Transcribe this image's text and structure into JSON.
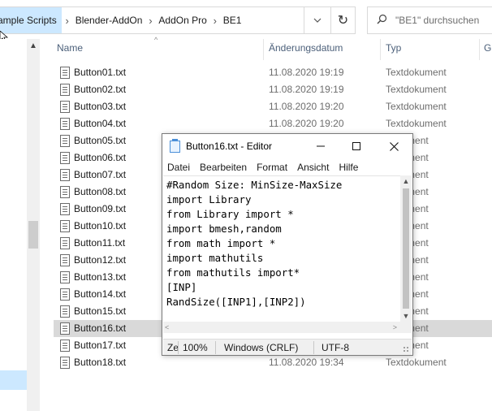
{
  "explorer": {
    "breadcrumbs": [
      "ample Scripts",
      "Blender-AddOn",
      "AddOn Pro",
      "BE1"
    ],
    "search_placeholder": "\"BE1\" durchsuchen",
    "columns": {
      "name": "Name",
      "date": "Änderungsdatum",
      "type": "Typ",
      "size": "Gr"
    },
    "files": [
      {
        "name": "Button01.txt",
        "date": "11.08.2020 19:19",
        "type": "Textdokument"
      },
      {
        "name": "Button02.txt",
        "date": "11.08.2020 19:19",
        "type": "Textdokument"
      },
      {
        "name": "Button03.txt",
        "date": "11.08.2020 19:20",
        "type": "Textdokument"
      },
      {
        "name": "Button04.txt",
        "date": "11.08.2020 19:20",
        "type": "Textdokument"
      },
      {
        "name": "Button05.txt",
        "date": "",
        "type": "dokument"
      },
      {
        "name": "Button06.txt",
        "date": "",
        "type": "dokument"
      },
      {
        "name": "Button07.txt",
        "date": "",
        "type": "dokument"
      },
      {
        "name": "Button08.txt",
        "date": "",
        "type": "dokument"
      },
      {
        "name": "Button09.txt",
        "date": "",
        "type": "dokument"
      },
      {
        "name": "Button10.txt",
        "date": "",
        "type": "dokument"
      },
      {
        "name": "Button11.txt",
        "date": "",
        "type": "dokument"
      },
      {
        "name": "Button12.txt",
        "date": "",
        "type": "dokument"
      },
      {
        "name": "Button13.txt",
        "date": "",
        "type": "dokument"
      },
      {
        "name": "Button14.txt",
        "date": "",
        "type": "dokument"
      },
      {
        "name": "Button15.txt",
        "date": "",
        "type": "dokument"
      },
      {
        "name": "Button16.txt",
        "date": "",
        "type": "dokument",
        "selected": true
      },
      {
        "name": "Button17.txt",
        "date": "",
        "type": "dokument"
      },
      {
        "name": "Button18.txt",
        "date": "11.08.2020 19:34",
        "type": "Textdokument"
      }
    ]
  },
  "notepad": {
    "title": "Button16.txt - Editor",
    "menu": [
      "Datei",
      "Bearbeiten",
      "Format",
      "Ansicht",
      "Hilfe"
    ],
    "lines": [
      "#Random Size: MinSize-MaxSize",
      "import Library",
      "from Library import *",
      "import bmesh,random",
      "from math import *",
      "import mathutils",
      "from mathutils import*",
      "[INP]",
      "RandSize([INP1],[INP2])"
    ],
    "status": {
      "position": "Ze",
      "zoom": "100%",
      "line_ending": "Windows (CRLF)",
      "encoding": "UTF-8"
    }
  }
}
